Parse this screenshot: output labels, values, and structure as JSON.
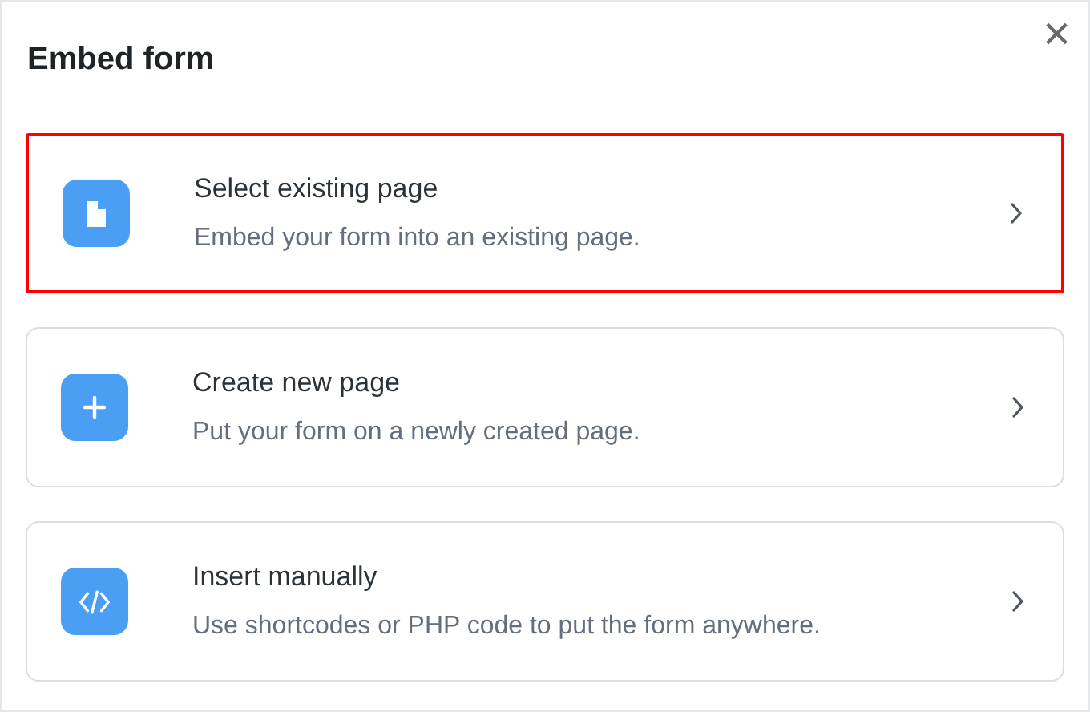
{
  "dialog": {
    "title": "Embed form",
    "close": "×"
  },
  "options": [
    {
      "kind": "file",
      "title": "Select existing page",
      "description": "Embed your form into an existing page.",
      "selected": true
    },
    {
      "kind": "plus",
      "title": "Create new page",
      "description": "Put your form on a newly created page.",
      "selected": false
    },
    {
      "kind": "code",
      "title": "Insert manually",
      "description": "Use shortcodes or PHP code to put the form anywhere.",
      "selected": false
    }
  ]
}
